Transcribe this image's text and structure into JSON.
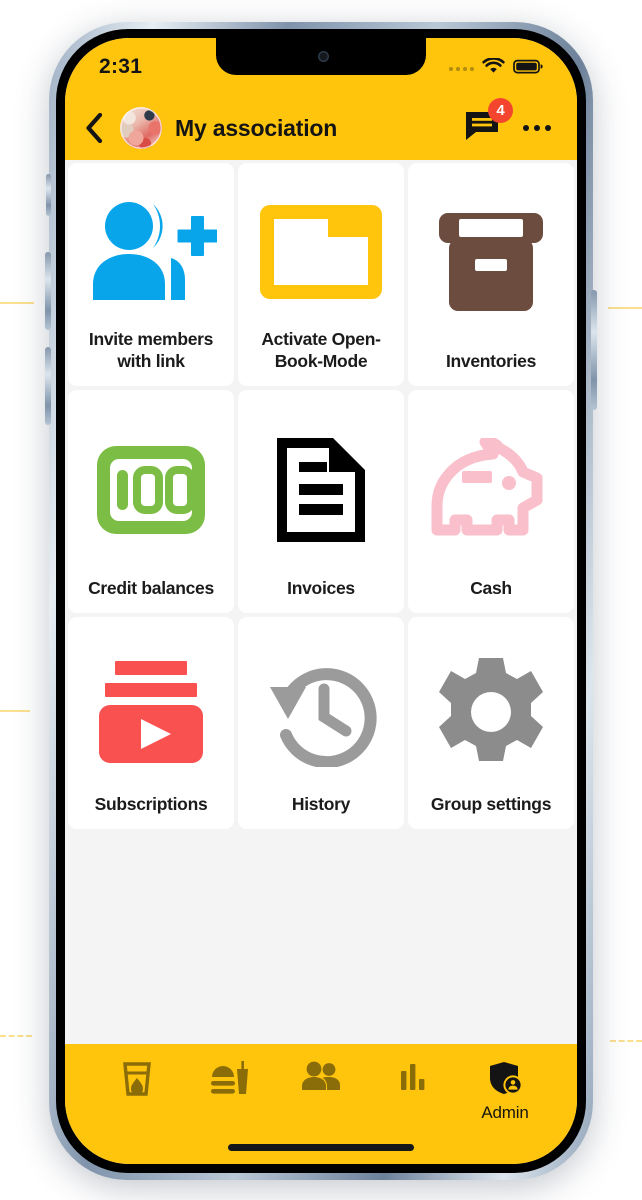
{
  "theme": {
    "brand_yellow": "#ffc40c",
    "page_bg": "#f4f4f5",
    "tile_bg": "#ffffff",
    "badge_red": "#f4462e",
    "nav_icon": "#8a6c09",
    "text_dark": "#1b1b1b"
  },
  "statusbar": {
    "time": "2:31",
    "signal_icon": "signal-dots-icon",
    "wifi_icon": "wifi-icon",
    "battery_icon": "battery-full-icon"
  },
  "appbar": {
    "back_icon": "chevron-left-icon",
    "avatar_icon": "group-avatar",
    "title": "My association",
    "chat_icon": "chat-bubble-icon",
    "chat_badge_count": "4",
    "more_icon": "more-horizontal-icon"
  },
  "grid": {
    "tiles": [
      {
        "label": "Invite members with link",
        "icon": "person-add-icon",
        "color": "#09a5eb"
      },
      {
        "label": "Activate Open-Book-Mode",
        "icon": "folder-open-icon",
        "color": "#ffc40c"
      },
      {
        "label": "Inventories",
        "icon": "storage-box-icon",
        "color": "#6b4c3e"
      },
      {
        "label": "Credit balances",
        "icon": "hundred-credit-icon",
        "color": "#7cbe45"
      },
      {
        "label": "Invoices",
        "icon": "document-icon",
        "color": "#000000"
      },
      {
        "label": "Cash",
        "icon": "piggy-bank-icon",
        "color": "#f9bfcb"
      },
      {
        "label": "Subscriptions",
        "icon": "subscriptions-icon",
        "color": "#f95050"
      },
      {
        "label": "History",
        "icon": "history-clock-icon",
        "color": "#9b9b9b"
      },
      {
        "label": "Group settings",
        "icon": "gear-icon",
        "color": "#8c8c8c"
      }
    ]
  },
  "bottomnav": {
    "items": [
      {
        "icon": "drink-glass-icon",
        "label": ""
      },
      {
        "icon": "food-burger-icon",
        "label": ""
      },
      {
        "icon": "people-icon",
        "label": ""
      },
      {
        "icon": "bar-stats-icon",
        "label": ""
      },
      {
        "icon": "admin-shield-icon",
        "label": "Admin"
      }
    ]
  }
}
